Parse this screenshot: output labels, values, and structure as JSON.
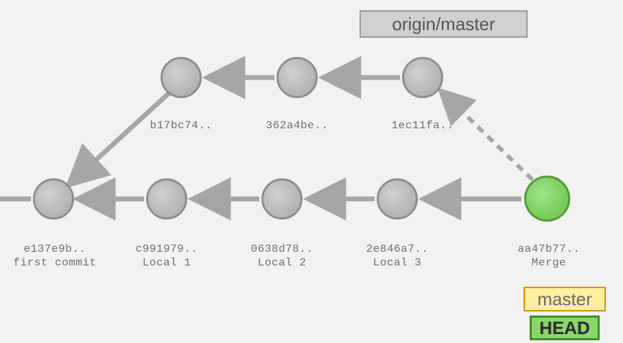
{
  "refs": {
    "origin_master": "origin/master",
    "master": "master",
    "head": "HEAD"
  },
  "commits": {
    "c0": {
      "hash": "e137e9b..",
      "msg": "first commit"
    },
    "c1": {
      "hash": "c991979..",
      "msg": "Local 1"
    },
    "c2": {
      "hash": "0638d78..",
      "msg": "Local 2"
    },
    "c3": {
      "hash": "2e846a7..",
      "msg": "Local 3"
    },
    "c4": {
      "hash": "aa47b77..",
      "msg": "Merge"
    },
    "u1": {
      "hash": "b17bc74.."
    },
    "u2": {
      "hash": "362a4be.."
    },
    "u3": {
      "hash": "1ec11fa.."
    }
  },
  "chart_data": {
    "type": "diagram",
    "description": "Git commit DAG showing a merge of origin/master into local master",
    "nodes": [
      {
        "id": "e137e9b",
        "label": "first commit",
        "row": "bottom"
      },
      {
        "id": "c991979",
        "label": "Local 1",
        "row": "bottom"
      },
      {
        "id": "0638d78",
        "label": "Local 2",
        "row": "bottom"
      },
      {
        "id": "2e846a7",
        "label": "Local 3",
        "row": "bottom"
      },
      {
        "id": "aa47b77",
        "label": "Merge",
        "row": "bottom",
        "head": true
      },
      {
        "id": "b17bc74",
        "row": "top"
      },
      {
        "id": "362a4be",
        "row": "top"
      },
      {
        "id": "1ec11fa",
        "row": "top"
      }
    ],
    "edges": [
      {
        "from": "c991979",
        "to": "e137e9b"
      },
      {
        "from": "0638d78",
        "to": "c991979"
      },
      {
        "from": "2e846a7",
        "to": "0638d78"
      },
      {
        "from": "aa47b77",
        "to": "2e846a7"
      },
      {
        "from": "b17bc74",
        "to": "e137e9b"
      },
      {
        "from": "362a4be",
        "to": "b17bc74"
      },
      {
        "from": "1ec11fa",
        "to": "362a4be"
      },
      {
        "from": "aa47b77",
        "to": "1ec11fa",
        "style": "dashed"
      }
    ],
    "refs": [
      {
        "name": "origin/master",
        "points_to": "1ec11fa"
      },
      {
        "name": "master",
        "points_to": "aa47b77"
      },
      {
        "name": "HEAD",
        "points_to": "aa47b77"
      }
    ]
  }
}
